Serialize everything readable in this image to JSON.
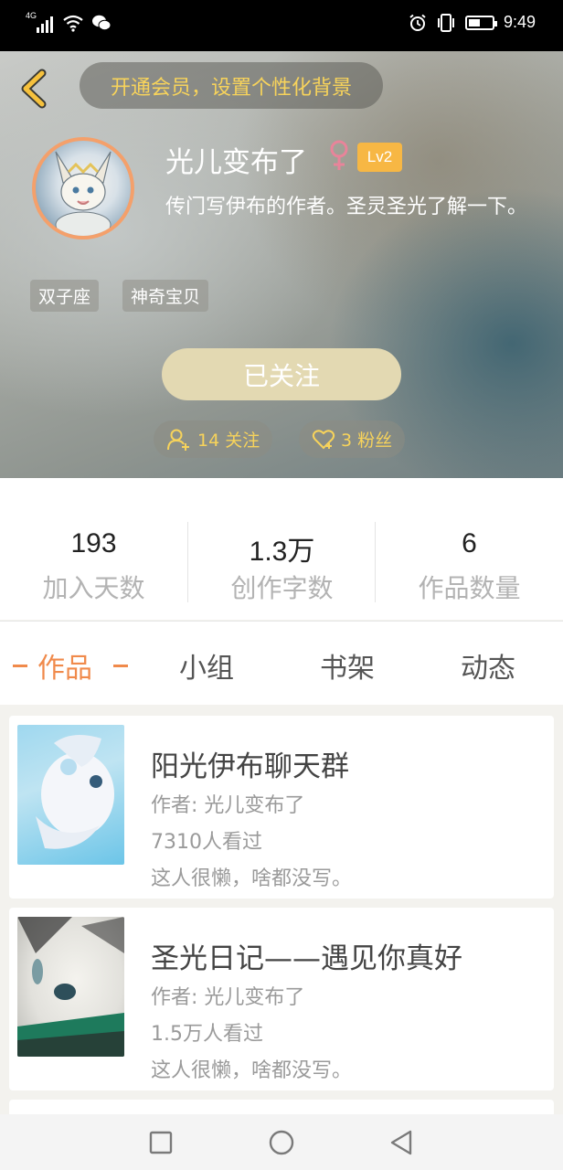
{
  "status_bar": {
    "network": "4G",
    "time": "9:49"
  },
  "header": {
    "vip_banner": "开通会员，设置个性化背景"
  },
  "profile": {
    "nickname": "光儿变布了",
    "level": "Lv2",
    "bio": "传门写伊布的作者。圣灵圣光了解一下。",
    "tags": [
      "双子座",
      "神奇宝贝"
    ],
    "follow_button": "已关注",
    "following": "14 关注",
    "fans": "3 粉丝"
  },
  "stats": [
    {
      "value": "193",
      "label": "加入天数"
    },
    {
      "value": "1.3万",
      "label": "创作字数"
    },
    {
      "value": "6",
      "label": "作品数量"
    }
  ],
  "tabs": [
    {
      "label": "作品",
      "active": true
    },
    {
      "label": "小组",
      "active": false
    },
    {
      "label": "书架",
      "active": false
    },
    {
      "label": "动态",
      "active": false
    }
  ],
  "works": [
    {
      "title": "阳光伊布聊天群",
      "author": "作者: 光儿变布了",
      "views": "7310人看过",
      "desc": "这人很懒，啥都没写。"
    },
    {
      "title": "圣光日记——遇见你真好",
      "author": "作者: 光儿变布了",
      "views": "1.5万人看过",
      "desc": "这人很懒，啥都没写。"
    }
  ],
  "colors": {
    "accent": "#f08a4b",
    "gold": "#f7d35b",
    "level_badge": "#f7b744",
    "follow_button": "#e3d9b2",
    "female": "#e8849a"
  },
  "icons": [
    "back-arrow-icon",
    "female-icon",
    "follow-user-icon",
    "heart-icon",
    "square-nav-icon",
    "circle-nav-icon",
    "triangle-back-nav-icon"
  ]
}
